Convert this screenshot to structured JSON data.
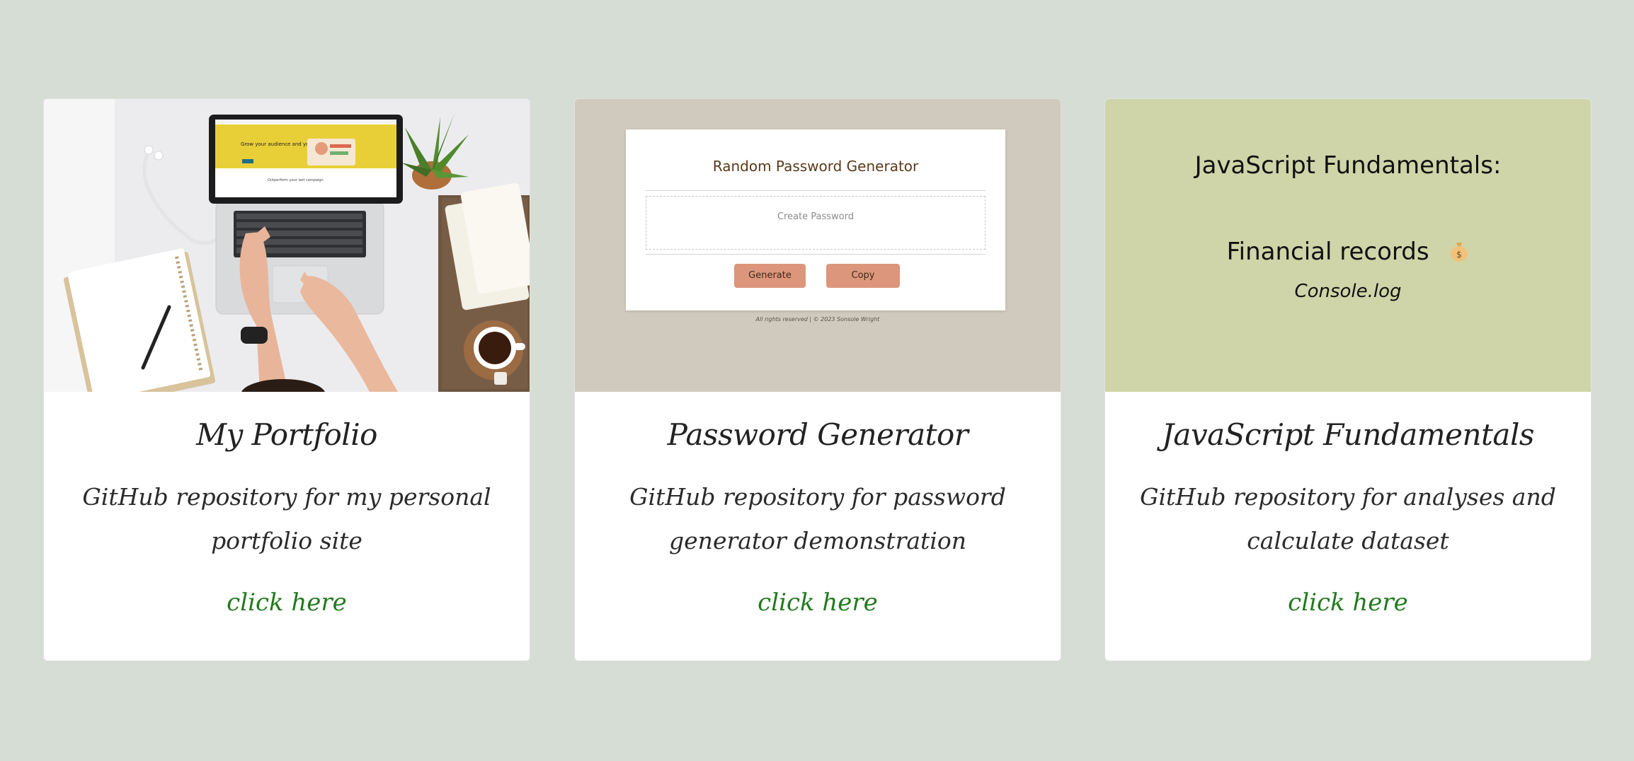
{
  "cards": [
    {
      "title": "My Portfolio",
      "description": "GitHub repository for my personal portfolio site",
      "link_label": "click here",
      "image": {
        "kind": "photo",
        "subject": "laptop-workspace",
        "screen_heading": "Grow your audience and your revenue",
        "screen_subtext": "Outperform your last campaign"
      }
    },
    {
      "title": "Password Generator",
      "description": "GitHub repository for password generator demonstration",
      "link_label": "click here",
      "preview": {
        "heading": "Random Password Generator",
        "field_placeholder": "Create Password",
        "generate_label": "Generate",
        "copy_label": "Copy",
        "footer": "All rights reserved | © 2023 Sonsole Wright"
      }
    },
    {
      "title": "JavaScript Fundamentals",
      "description": "GitHub repository for analyses and calculate dataset",
      "link_label": "click here",
      "preview": {
        "line1": "JavaScript Fundamentals:",
        "line2": "Financial records",
        "line2_icon": "money-bag-icon",
        "line3": "Console.log"
      }
    }
  ],
  "colors": {
    "page_background": "#d6ddd5",
    "card_background": "#ffffff",
    "link": "#217a1d",
    "password_preview_background": "#d0cabe",
    "password_button": "#dc967b",
    "js_preview_background": "#cfd5a8"
  }
}
